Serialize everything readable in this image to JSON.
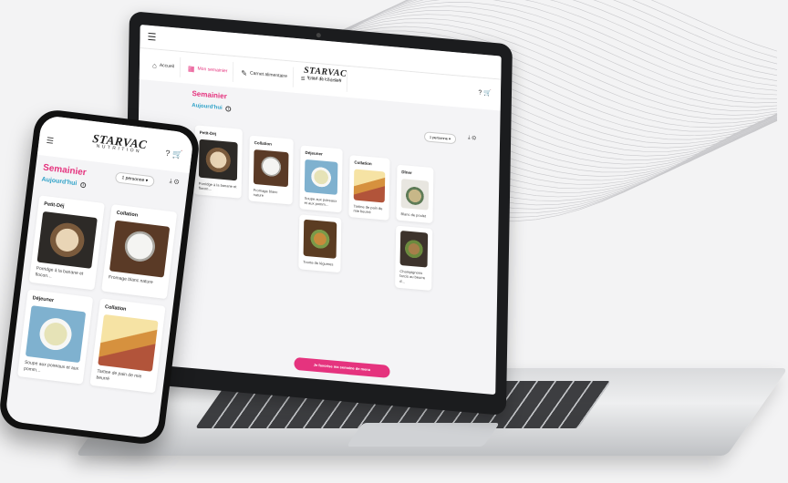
{
  "brand": {
    "logo_top": "STARVAC",
    "logo_bottom": "NUTRITION"
  },
  "laptop": {
    "nav_tabs": [
      {
        "label": "Accueil",
        "icon": "home-icon"
      },
      {
        "label": "Mon semainier",
        "icon": "calendar-icon"
      },
      {
        "label": "Carnet alimentaire",
        "icon": "notebook-icon"
      },
      {
        "label": "Liste de courses",
        "icon": "list-icon"
      }
    ],
    "title": "Semainier",
    "subtitle": "Aujourd'hui",
    "people_select": "1 personne",
    "meals": [
      {
        "heading": "Petit-Déj",
        "dishes": [
          {
            "name": "Porridge à la banane et flocon…",
            "img": "porridge"
          }
        ]
      },
      {
        "heading": "Collation",
        "dishes": [
          {
            "name": "Fromage blanc nature",
            "img": "yogurt"
          }
        ]
      },
      {
        "heading": "Déjeuner",
        "dishes": [
          {
            "name": "Soupe aux poireaux et aux pomm…",
            "img": "soup"
          },
          {
            "name": "Tourte de légumes",
            "img": "tart"
          }
        ]
      },
      {
        "heading": "Collation",
        "dishes": [
          {
            "name": "Tartine de pain de mie beurré",
            "img": "toast"
          }
        ]
      },
      {
        "heading": "Dîner",
        "dishes": [
          {
            "name": "Blanc de poulet",
            "img": "dinner"
          },
          {
            "name": "Champignons farcis au beurre d…",
            "img": "champi"
          }
        ]
      }
    ],
    "cta": "Je favorise ma semaine de menu"
  },
  "phone": {
    "title": "Semainier",
    "subtitle": "Aujourd'hui",
    "people_select": "1 personne",
    "meals": [
      {
        "heading": "Petit-Déj",
        "dish": "Porridge à la banane et flocon…",
        "img": "porridge"
      },
      {
        "heading": "Collation",
        "dish": "Fromage blanc nature",
        "img": "yogurt"
      },
      {
        "heading": "Déjeuner",
        "dish": "Soupe aux poireaux et aux pomm…",
        "img": "soup"
      },
      {
        "heading": "Collation",
        "dish": "Tartine de pain de mie beurré",
        "img": "toast"
      }
    ]
  },
  "colors": {
    "accent_pink": "#e5337e",
    "accent_blue": "#2fa2c8"
  }
}
